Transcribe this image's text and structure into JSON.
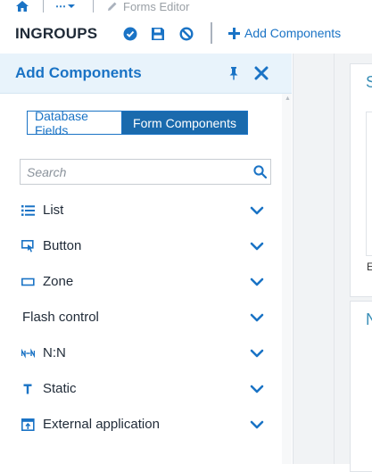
{
  "topbar": {
    "home_icon": "home-icon",
    "more_label": "⋯",
    "breadcrumb_current": "Forms Editor",
    "title": "INGROUPS",
    "add_components_label": "Add Components"
  },
  "panel": {
    "title": "Add Components",
    "tabs": [
      {
        "label": "Database Fields",
        "active": false
      },
      {
        "label": "Form Components",
        "active": true
      }
    ],
    "search_placeholder": "Search",
    "items": [
      {
        "label": "List",
        "icon": "list-icon"
      },
      {
        "label": "Button",
        "icon": "button-cursor-icon"
      },
      {
        "label": "Zone",
        "icon": "zone-rectangle-icon"
      },
      {
        "label": "Flash control",
        "icon": ""
      },
      {
        "label": "N:N",
        "icon": "n-n-relation-icon"
      },
      {
        "label": "Static",
        "icon": "text-t-icon"
      },
      {
        "label": "External application",
        "icon": "external-app-icon"
      }
    ]
  },
  "right": {
    "card1_letter": "S",
    "card1_small": "E",
    "card2_letter": "N"
  },
  "colors": {
    "accent": "#1a73c5",
    "active_tab": "#1a6aad",
    "panel_header_bg": "#e8f3fb"
  }
}
